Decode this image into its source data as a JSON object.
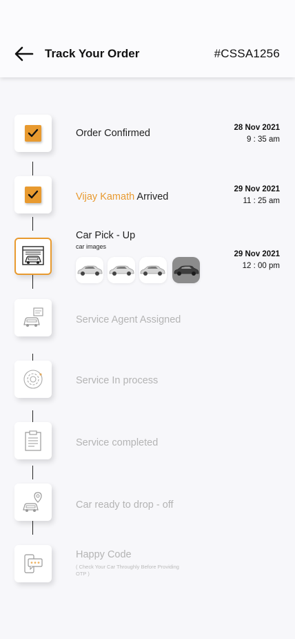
{
  "header": {
    "title": "Track Your Order",
    "order_id": "#CSSA1256"
  },
  "steps": [
    {
      "label": "Order Confirmed",
      "date": "28 Nov 2021",
      "time": "9 : 35 am",
      "status": "done"
    },
    {
      "name": "Vijay Kamath",
      "label": "Arrived",
      "date": "29 Nov 2021",
      "time": "11 : 25 am",
      "status": "done"
    },
    {
      "label": "Car Pick - Up",
      "sublabel": "car  images",
      "date": "29 Nov 2021",
      "time": "12 : 00 pm",
      "status": "active"
    },
    {
      "label": "Service Agent Assigned",
      "status": "pending"
    },
    {
      "label": "Service In process",
      "status": "pending"
    },
    {
      "label": "Service completed",
      "status": "pending"
    },
    {
      "label": "Car ready to drop - off",
      "status": "pending"
    },
    {
      "label": "Happy Code",
      "note": "( Check Your Car Throughly Before Providing OTP )",
      "status": "pending"
    }
  ],
  "colors": {
    "accent": "#e89a2f",
    "pending_text": "#b4b4b4"
  }
}
